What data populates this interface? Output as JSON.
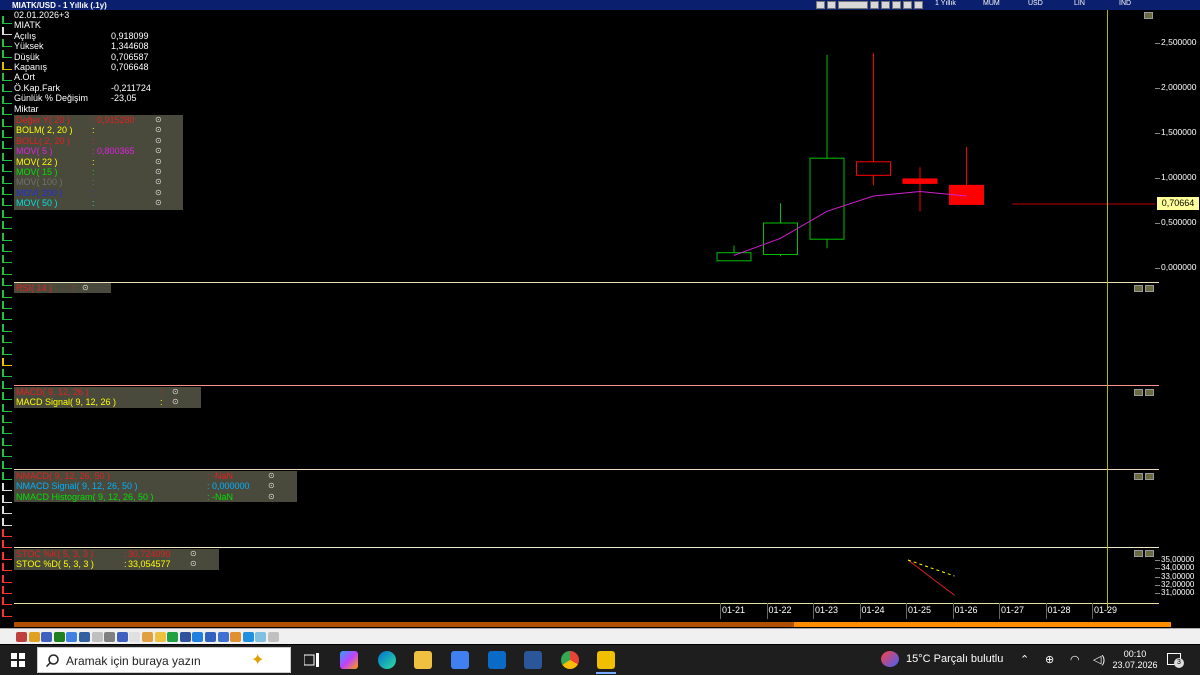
{
  "window": {
    "title": "MIATK/USD - 1 Yıllık (.1y)",
    "toolbar_items": [
      "1 Yıllık",
      "MUM",
      "USD",
      "LIN",
      "IND"
    ]
  },
  "info": {
    "date": "02.01.2026+3",
    "symbol": "MIATK",
    "rows": [
      {
        "label": "Açılış",
        "value": "0,918099"
      },
      {
        "label": "Yüksek",
        "value": "1,344608"
      },
      {
        "label": "Düşük",
        "value": "0,706587"
      },
      {
        "label": "Kapanış",
        "value": "0,706648"
      },
      {
        "label": "A.Ort",
        "value": ""
      },
      {
        "label": "Ö.Kap.Fark",
        "value": "-0,211724"
      },
      {
        "label": "Günlük % Değişim",
        "value": "-23,05"
      },
      {
        "label": "Miktar",
        "value": ""
      }
    ]
  },
  "price_indicators": [
    {
      "label": "Değer Y( 20 )",
      "value": "0,915280",
      "color": "#e02020"
    },
    {
      "label": "BOLM( 2, 20 )",
      "value": "",
      "color": "#ffff00"
    },
    {
      "label": "BOLL( 2, 20 )",
      "value": "",
      "color": "#e02020"
    },
    {
      "label": "MOV( 5 )",
      "value": "0,800365",
      "color": "#e020e0"
    },
    {
      "label": "MOV( 22 )",
      "value": "",
      "color": "#ffff00"
    },
    {
      "label": "MOV( 15 )",
      "value": "",
      "color": "#00e000"
    },
    {
      "label": "MOV( 100 )",
      "value": "",
      "color": "#707070"
    },
    {
      "label": "MOV( 200 )",
      "value": "",
      "color": "#2030e0"
    },
    {
      "label": "MOV( 50 )",
      "value": "",
      "color": "#00e0e0"
    }
  ],
  "rsi_indicators": [
    {
      "label": "RSI( 14 )",
      "value": "",
      "color": "#e02020"
    }
  ],
  "macd_indicators": [
    {
      "label": "MACD( 9, 12, 26 )",
      "value": "",
      "color": "#e02020"
    },
    {
      "label": "MACD Signal( 9, 12, 26 )",
      "value": "",
      "color": "#ffff00"
    }
  ],
  "nmacd_indicators": [
    {
      "label": "NMACD( 9, 12, 26, 50 )",
      "value": "-NaN",
      "color": "#e02020"
    },
    {
      "label": "NMACD Signal( 9, 12, 26, 50 )",
      "value": "0,000000",
      "color": "#00b0ff"
    },
    {
      "label": "NMACD Histogram( 9, 12, 26, 50 )",
      "value": "-NaN",
      "color": "#00e000"
    }
  ],
  "stoc_indicators": [
    {
      "label": "STOC %K( 5, 3, 3 )",
      "value": "30,724090",
      "color": "#e02020"
    },
    {
      "label": "STOC %D( 5, 3, 3 )",
      "value": "33,054577",
      "color": "#ffff00"
    }
  ],
  "chart_data": {
    "type": "candlestick",
    "x": [
      "01-21",
      "01-22",
      "01-23",
      "01-24",
      "01-25",
      "01-26"
    ],
    "x_axis_labels": [
      "01-21",
      "01-22",
      "01-23",
      "01-24",
      "01-25",
      "01-26",
      "01-27",
      "01-28",
      "01-29"
    ],
    "candles": [
      {
        "date": "01-21",
        "open": 0.08,
        "high": 0.25,
        "low": 0.08,
        "close": 0.17,
        "direction": "up"
      },
      {
        "date": "01-22",
        "open": 0.15,
        "high": 0.72,
        "low": 0.13,
        "close": 0.5,
        "direction": "up"
      },
      {
        "date": "01-23",
        "open": 0.32,
        "high": 2.37,
        "low": 0.22,
        "close": 1.22,
        "direction": "up"
      },
      {
        "date": "01-24",
        "open": 1.18,
        "high": 2.39,
        "low": 0.92,
        "close": 1.03,
        "direction": "down"
      },
      {
        "date": "01-25",
        "open": 0.99,
        "high": 1.12,
        "low": 0.63,
        "close": 0.94,
        "direction": "down"
      },
      {
        "date": "01-26",
        "open": 0.918099,
        "high": 1.344608,
        "low": 0.706587,
        "close": 0.706648,
        "direction": "down"
      }
    ],
    "mov5": [
      0.14,
      0.33,
      0.63,
      0.8,
      0.85,
      0.800365
    ],
    "last_price_label": "0,70664",
    "y_ticks": [
      "2,500000",
      "2,000000",
      "1,500000",
      "1,000000",
      "0,500000",
      "0,000000"
    ],
    "ylim": [
      0,
      2.6
    ],
    "stoc": {
      "k": [
        {
          "date": "01-25",
          "value": 35.0
        },
        {
          "date": "01-26",
          "value": 30.72409
        }
      ],
      "d": [
        {
          "date": "01-25",
          "value": 35.0
        },
        {
          "date": "01-26",
          "value": 33.054577
        }
      ],
      "y_ticks": [
        "35,00000",
        "34,00000",
        "33,00000",
        "32,00000",
        "31,00000"
      ],
      "ylim": [
        30.5,
        35.2
      ]
    },
    "colors": {
      "up": "#00c000",
      "down": "#ff0000",
      "mov5": "#d020d0"
    }
  },
  "taskbar": {
    "search_placeholder": "Aramak için buraya yazın",
    "weather": "15°C  Parçalı bulutlu",
    "time": "00:10",
    "date": "23.07.2026",
    "notification_count": "3"
  }
}
